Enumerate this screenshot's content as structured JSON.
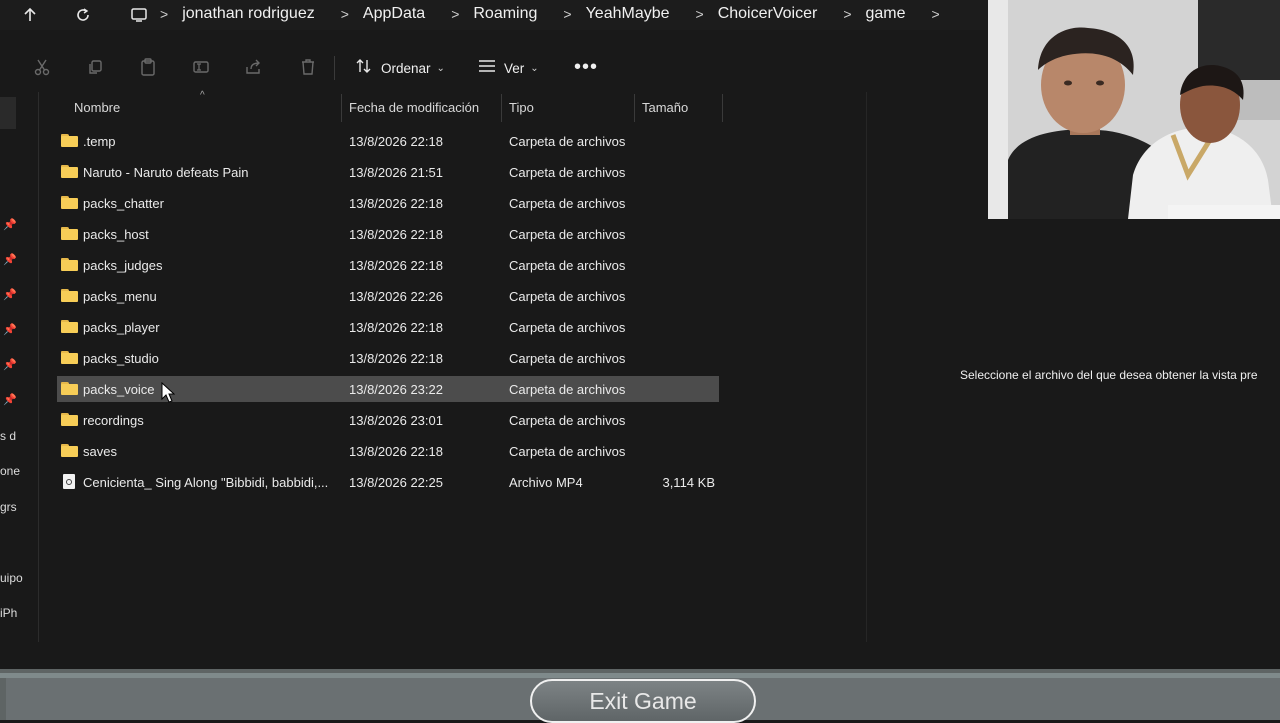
{
  "address_bar": {
    "crumbs": [
      "jonathan rodriguez",
      "AppData",
      "Roaming",
      "YeahMaybe",
      "ChoicerVoicer",
      "game"
    ],
    "separator": ">"
  },
  "toolbar": {
    "sort_label": "Ordenar",
    "view_label": "Ver",
    "more_label": "•••"
  },
  "columns": {
    "name": "Nombre",
    "date": "Fecha de modificación",
    "type": "Tipo",
    "size": "Tamaño"
  },
  "files": [
    {
      "name": ".temp",
      "date": "13/8/2026 22:18",
      "type": "Carpeta de archivos",
      "size": "",
      "kind": "folder"
    },
    {
      "name": "Naruto - Naruto defeats Pain",
      "date": "13/8/2026 21:51",
      "type": "Carpeta de archivos",
      "size": "",
      "kind": "folder"
    },
    {
      "name": "packs_chatter",
      "date": "13/8/2026 22:18",
      "type": "Carpeta de archivos",
      "size": "",
      "kind": "folder"
    },
    {
      "name": "packs_host",
      "date": "13/8/2026 22:18",
      "type": "Carpeta de archivos",
      "size": "",
      "kind": "folder"
    },
    {
      "name": "packs_judges",
      "date": "13/8/2026 22:18",
      "type": "Carpeta de archivos",
      "size": "",
      "kind": "folder"
    },
    {
      "name": "packs_menu",
      "date": "13/8/2026 22:26",
      "type": "Carpeta de archivos",
      "size": "",
      "kind": "folder"
    },
    {
      "name": "packs_player",
      "date": "13/8/2026 22:18",
      "type": "Carpeta de archivos",
      "size": "",
      "kind": "folder"
    },
    {
      "name": "packs_studio",
      "date": "13/8/2026 22:18",
      "type": "Carpeta de archivos",
      "size": "",
      "kind": "folder"
    },
    {
      "name": "packs_voice",
      "date": "13/8/2026 23:22",
      "type": "Carpeta de archivos",
      "size": "",
      "kind": "folder",
      "selected": true
    },
    {
      "name": "recordings",
      "date": "13/8/2026 23:01",
      "type": "Carpeta de archivos",
      "size": "",
      "kind": "folder"
    },
    {
      "name": "saves",
      "date": "13/8/2026 22:18",
      "type": "Carpeta de archivos",
      "size": "",
      "kind": "folder"
    },
    {
      "name": "Cenicienta_ Sing Along \"Bibbidi, babbidi,...",
      "date": "13/8/2026 22:25",
      "type": "Archivo MP4",
      "size": "3,114 KB",
      "kind": "file"
    }
  ],
  "sidebar_stubs": [
    "s d",
    "one",
    "grs",
    "uipo",
    "iPh"
  ],
  "preview": {
    "message": "Seleccione el archivo del que desea obtener la vista pre"
  },
  "game": {
    "exit_label": "Exit Game"
  },
  "colors": {
    "background": "#191919",
    "selected_row": "#4c4c4c",
    "folder": "#f7cd57",
    "bottom_bar": "#6a7072"
  }
}
